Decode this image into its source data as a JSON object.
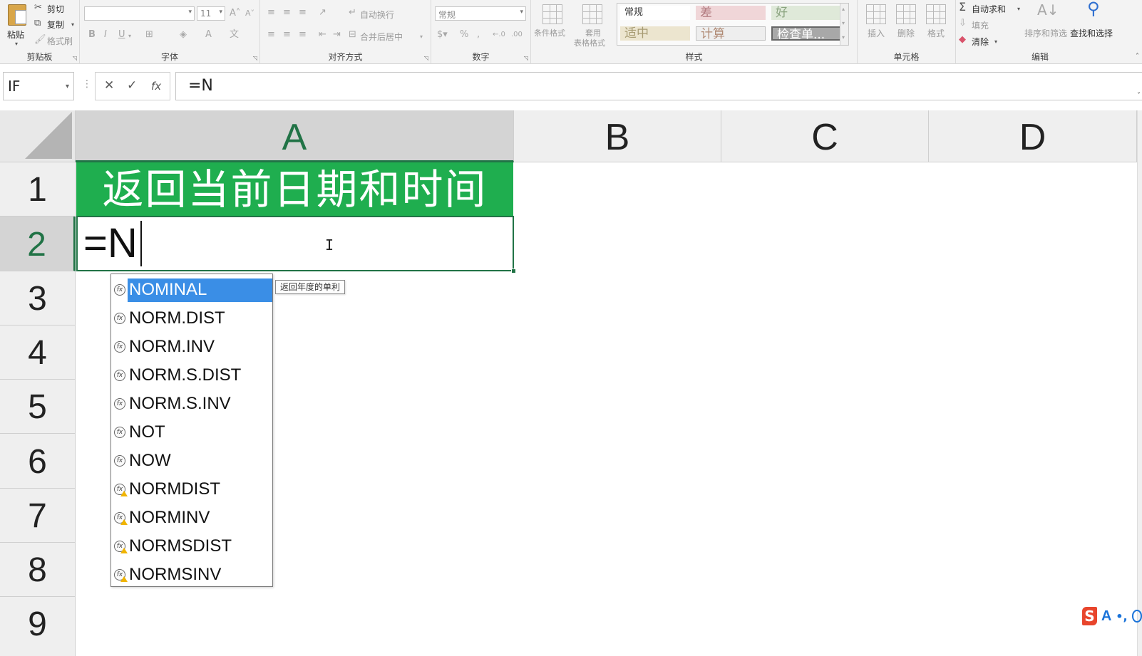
{
  "ribbon": {
    "clipboard": {
      "paste": "粘贴",
      "cut": "剪切",
      "copy": "复制",
      "format_painter": "格式刷",
      "label": "剪贴板"
    },
    "font": {
      "size": "11",
      "label": "字体"
    },
    "alignment": {
      "wrap_text": "自动换行",
      "merge_center": "合并后居中",
      "label": "对齐方式"
    },
    "number": {
      "format": "常规",
      "label": "数字"
    },
    "styles": {
      "conditional_format": "条件格式",
      "table_format_1": "套用",
      "table_format_2": "表格格式",
      "normal": "常规",
      "bad": "差",
      "good": "好",
      "neutral": "适中",
      "calculation": "计算",
      "check_cell": "检查单...",
      "label": "样式"
    },
    "cells": {
      "insert": "插入",
      "delete": "删除",
      "format": "格式",
      "label": "单元格"
    },
    "editing": {
      "autosum": "自动求和",
      "fill": "填充",
      "clear": "清除",
      "sort_filter": "排序和筛选",
      "find_select": "查找和选择",
      "label": "编辑"
    }
  },
  "formula_bar": {
    "name_box": "IF",
    "formula": "=N"
  },
  "columns": [
    "A",
    "B",
    "C",
    "D"
  ],
  "rows": [
    "1",
    "2",
    "3",
    "4",
    "5",
    "6",
    "7",
    "8",
    "9"
  ],
  "cells": {
    "a1": "返回当前日期和时间",
    "a2": "=N"
  },
  "autocomplete": {
    "items": [
      {
        "name": "NOMINAL",
        "legacy": false
      },
      {
        "name": "NORM.DIST",
        "legacy": false
      },
      {
        "name": "NORM.INV",
        "legacy": false
      },
      {
        "name": "NORM.S.DIST",
        "legacy": false
      },
      {
        "name": "NORM.S.INV",
        "legacy": false
      },
      {
        "name": "NOT",
        "legacy": false
      },
      {
        "name": "NOW",
        "legacy": false
      },
      {
        "name": "NORMDIST",
        "legacy": true
      },
      {
        "name": "NORMINV",
        "legacy": true
      },
      {
        "name": "NORMSDIST",
        "legacy": true
      },
      {
        "name": "NORMSINV",
        "legacy": true
      }
    ],
    "selected_index": 0,
    "tooltip": "返回年度的单利"
  },
  "ime": {
    "logo": "S",
    "mode": "A",
    "punct": "•,"
  },
  "colors": {
    "excel_green": "#217346",
    "header_fill": "#1fae4f",
    "selection_blue": "#3a8ee6"
  }
}
